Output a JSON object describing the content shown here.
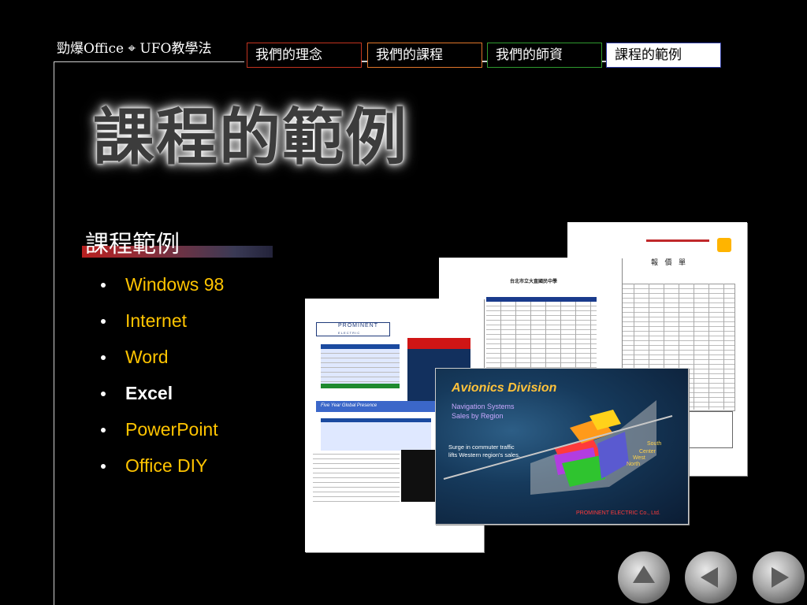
{
  "brand": "勁爆Office ⌖ UFO教學法",
  "tabs": [
    {
      "label": "我們的理念"
    },
    {
      "label": "我們的課程"
    },
    {
      "label": "我們的師資"
    },
    {
      "label": "課程的範例"
    }
  ],
  "page_title": "課程的範例",
  "section_title": "課程範例",
  "courses": [
    {
      "label": "Windows 98"
    },
    {
      "label": "Internet"
    },
    {
      "label": "Word"
    },
    {
      "label": "Excel"
    },
    {
      "label": "PowerPoint"
    },
    {
      "label": "Office DIY"
    }
  ],
  "active_course": "Excel",
  "collage": {
    "invoice_title": "報 價 單",
    "school_title": "台北市立大直國民中學",
    "prominent_logo": "PROMINENT",
    "prominent_sub": "E L E C T R I C",
    "five_year": "Five Year Global Presence",
    "avionics_title": "Avionics Division",
    "nav_line1": "Navigation Systems",
    "nav_line2": "Sales by Region",
    "surge_line1": "Surge in commuter traffic",
    "surge_line2": "lifts Western region's sales.",
    "footer": "PROMINENT ELECTRIC Co., Ltd.",
    "region_south": "South",
    "region_center": "Center",
    "region_west": "West",
    "region_north": "North"
  },
  "nav_buttons": [
    {
      "icon": "up-arrow-icon"
    },
    {
      "icon": "left-arrow-icon"
    },
    {
      "icon": "right-arrow-icon"
    }
  ],
  "colors": {
    "course_text": "#ffc400",
    "tab1_border": "#c2331f",
    "tab2_border": "#e0762a",
    "tab3_border": "#2f9a2f",
    "tab4_border": "#2c3aa0"
  }
}
